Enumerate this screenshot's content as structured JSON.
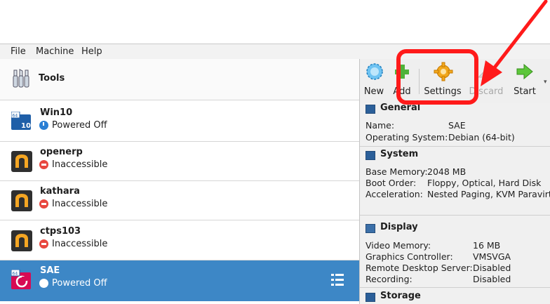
{
  "menu": {
    "file": "File",
    "machine": "Machine",
    "help": "Help"
  },
  "tools": {
    "label": "Tools"
  },
  "vms": [
    {
      "name": "Win10",
      "state": "Powered Off"
    },
    {
      "name": "openerp",
      "state": "Inaccessible"
    },
    {
      "name": "kathara",
      "state": "Inaccessible"
    },
    {
      "name": "ctps103",
      "state": "Inaccessible"
    },
    {
      "name": "SAE",
      "state": "Powered Off"
    }
  ],
  "toolbar": {
    "new": "New",
    "add": "Add",
    "settings": "Settings",
    "discard": "Discard",
    "start": "Start"
  },
  "details": {
    "general": {
      "title": "General",
      "name_label": "Name:",
      "name_value": "SAE",
      "os_label": "Operating System:",
      "os_value": "Debian (64-bit)"
    },
    "system": {
      "title": "System",
      "mem_label": "Base Memory:",
      "mem_value": "2048 MB",
      "boot_label": "Boot Order:",
      "boot_value": "Floppy, Optical, Hard Disk",
      "accel_label": "Acceleration:",
      "accel_value": "Nested Paging, KVM Paravirt"
    },
    "display": {
      "title": "Display",
      "vmem_label": "Video Memory:",
      "vmem_value": "16 MB",
      "gc_label": "Graphics Controller:",
      "gc_value": "VMSVGA",
      "rds_label": "Remote Desktop Server:",
      "rds_value": "Disabled",
      "rec_label": "Recording:",
      "rec_value": "Disabled"
    },
    "storage": {
      "title": "Storage"
    }
  },
  "colors": {
    "selection": "#3d87c6",
    "annotation": "#ff1a1a"
  }
}
